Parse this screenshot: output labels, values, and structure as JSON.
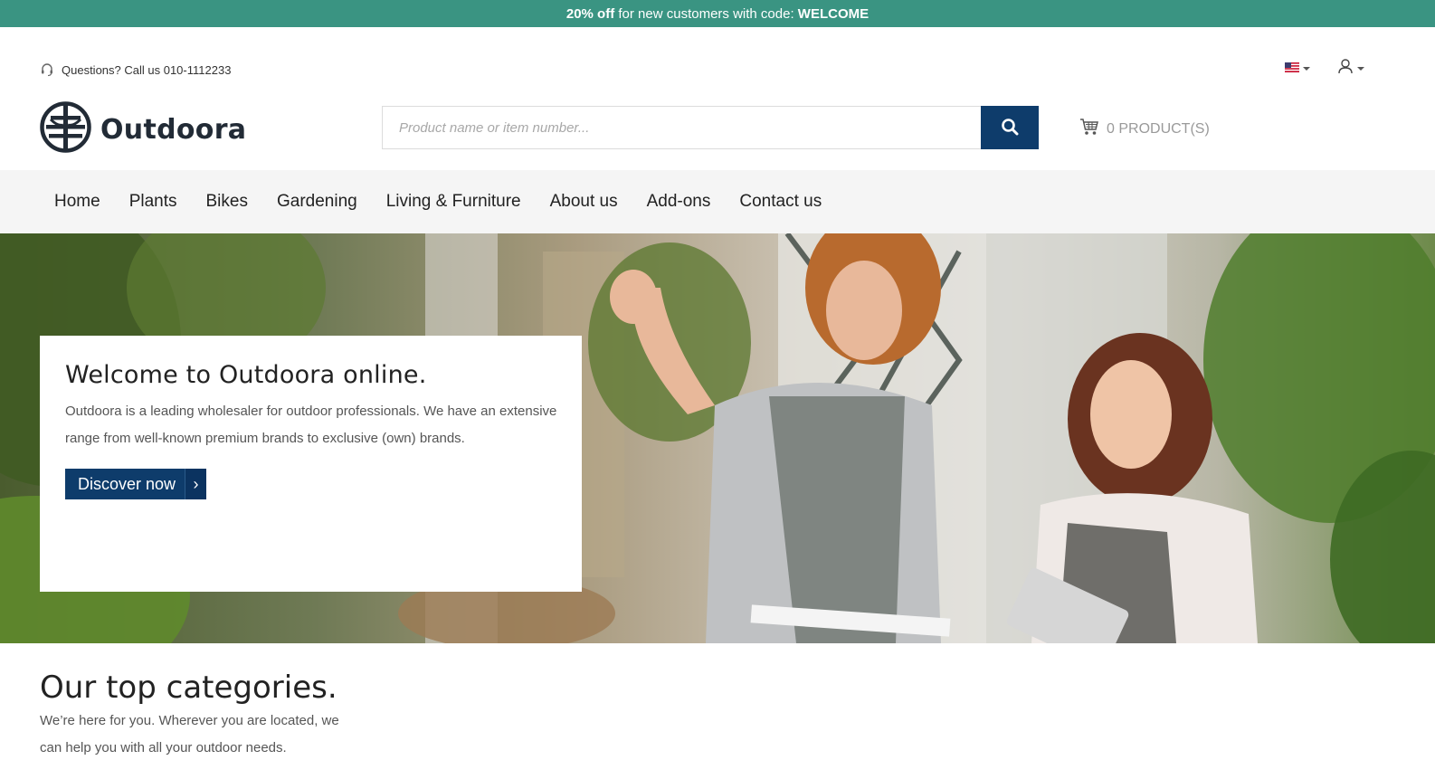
{
  "promo": {
    "highlight": "20% off",
    "text": " for new customers with code: ",
    "code": "WELCOME"
  },
  "utility": {
    "phone_text": "Questions? Call us 010-1112233",
    "language_icon": "us-flag-icon",
    "account_icon": "user-icon"
  },
  "header": {
    "logo_text": "Outdoora",
    "search_placeholder": "Product name or item number...",
    "cart_label": "0 PRODUCT(S)"
  },
  "nav": {
    "items": [
      "Home",
      "Plants",
      "Bikes",
      "Gardening",
      "Living & Furniture",
      "About us",
      "Add-ons",
      "Contact us"
    ]
  },
  "hero": {
    "title": "Welcome to Outdoora online.",
    "text": "Outdoora is a leading wholesaler for outdoor professionals. We have an extensive range from well-known premium brands to exclusive (own) brands.",
    "button_label": "Discover now",
    "button_arrow": "›"
  },
  "categories": {
    "title": "Our top categories.",
    "subtitle": "We’re here for you. Wherever you are located, we can help you with all your outdoor needs."
  },
  "colors": {
    "promo_bg": "#3a9482",
    "primary": "#0e3c6b",
    "nav_bg": "#f5f5f5"
  }
}
